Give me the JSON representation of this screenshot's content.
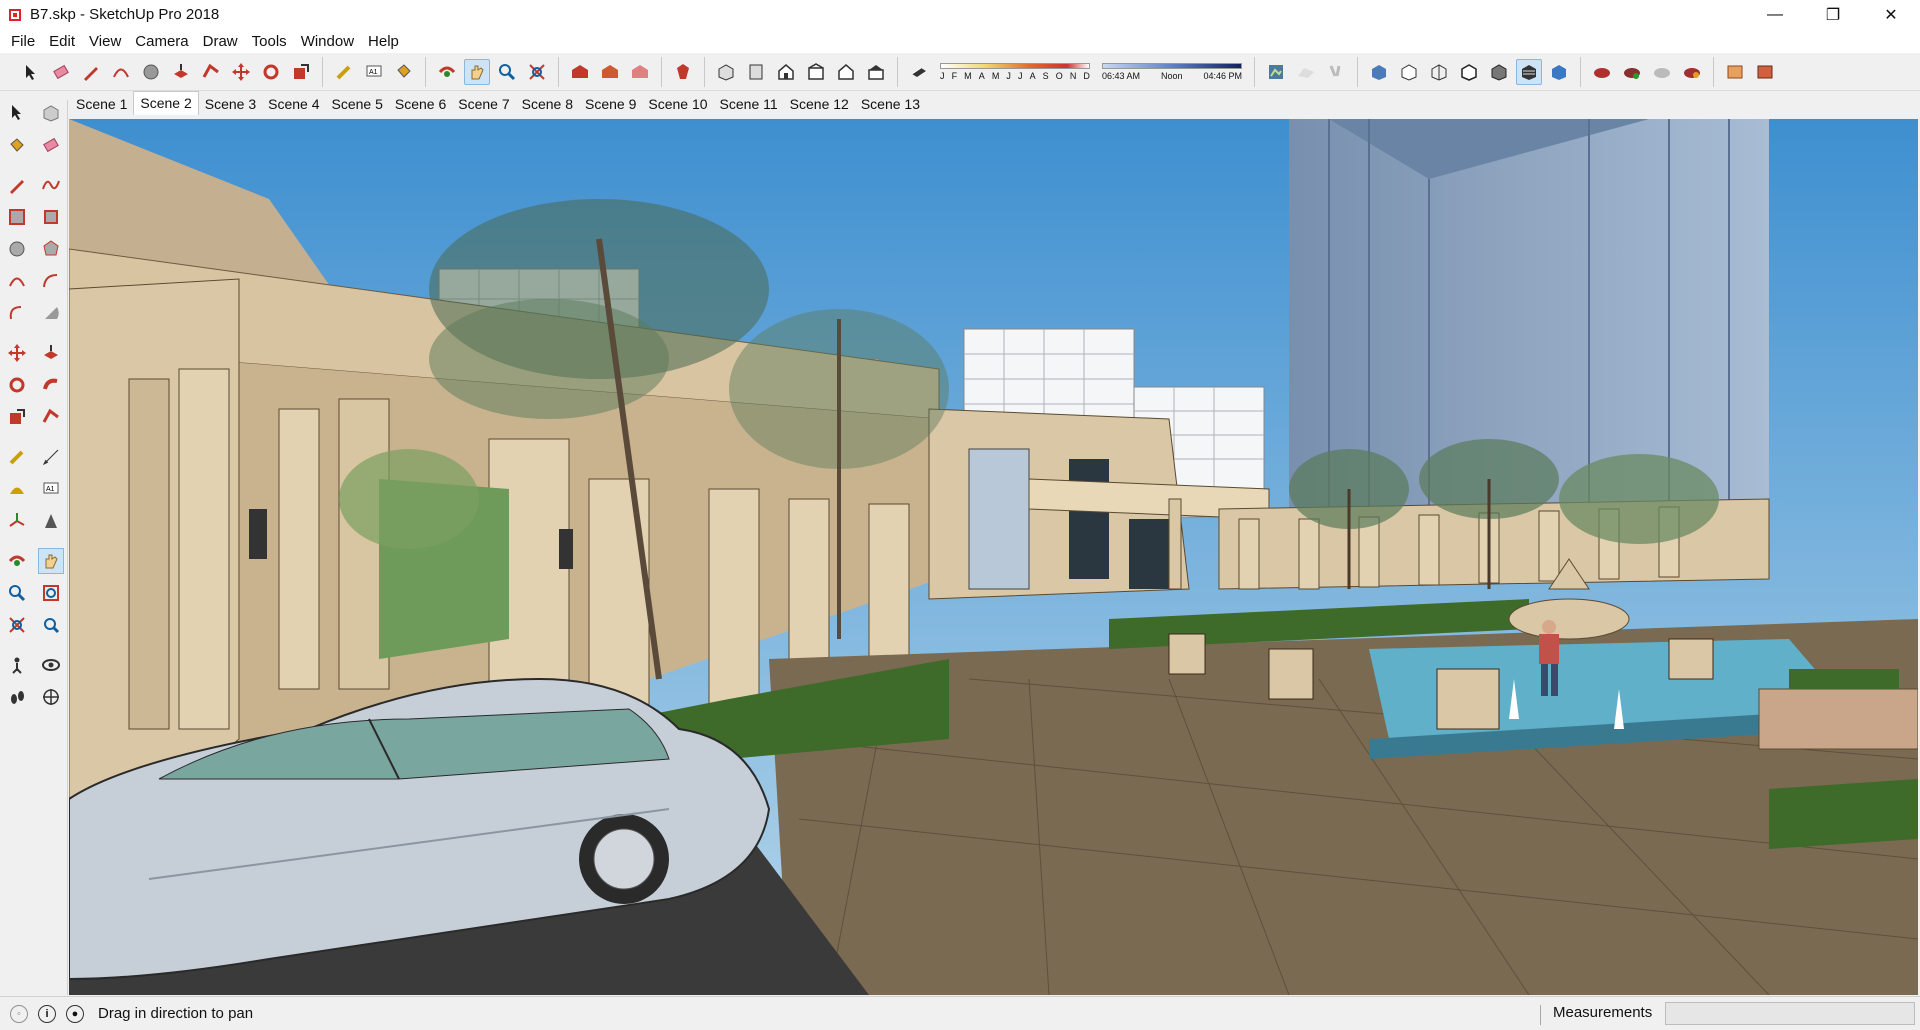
{
  "window": {
    "title": "B7.skp - SketchUp Pro 2018",
    "minimize": "—",
    "maximize": "❐",
    "close": "✕"
  },
  "menu": [
    "File",
    "Edit",
    "View",
    "Camera",
    "Draw",
    "Tools",
    "Window",
    "Help"
  ],
  "shadow_settings": {
    "months": [
      "J",
      "F",
      "M",
      "A",
      "M",
      "J",
      "J",
      "A",
      "S",
      "O",
      "N",
      "D"
    ],
    "time_start": "06:43 AM",
    "time_mid": "Noon",
    "time_end": "04:46 PM"
  },
  "scenes": {
    "active": "Scene 2",
    "tabs": [
      "Scene 1",
      "Scene 2",
      "Scene 3",
      "Scene 4",
      "Scene 5",
      "Scene 6",
      "Scene 7",
      "Scene 8",
      "Scene 9",
      "Scene 10",
      "Scene 11",
      "Scene 12",
      "Scene 13"
    ]
  },
  "status": {
    "message": "Drag in direction to pan",
    "measurements_label": "Measurements",
    "measurements_value": ""
  },
  "colors": {
    "sky": "#5da2d6",
    "paving": "#7a6a52",
    "road": "#3a3a3a",
    "stone": "#d9c7a6",
    "grass": "#3e6b2a",
    "water": "#5fb0c8",
    "tower": "#8aa6c4",
    "car": "#c6cfd8"
  }
}
